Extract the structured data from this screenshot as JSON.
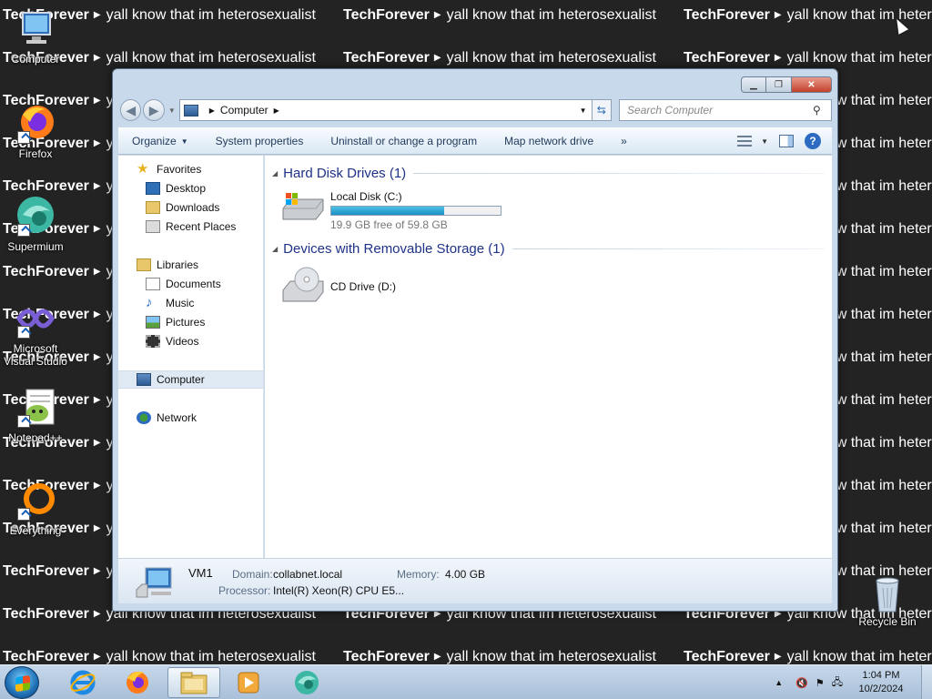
{
  "wallpaper": {
    "brand": "TechForever",
    "tagline": "yall know that im heterosexualist",
    "arrow_icon": "play-arrow-icon"
  },
  "desktop_icons": [
    {
      "id": "computer",
      "label": "Computer",
      "icon": "computer-icon"
    },
    {
      "id": "firefox",
      "label": "Firefox",
      "icon": "firefox-icon"
    },
    {
      "id": "supermium",
      "label": "Supermium",
      "icon": "supermium-icon"
    },
    {
      "id": "visual-studio",
      "label": "Microsoft Visual Studio",
      "icon": "visual-studio-icon"
    },
    {
      "id": "notepadpp",
      "label": "Notepad++",
      "icon": "notepadpp-icon"
    },
    {
      "id": "everything",
      "label": "Everything",
      "icon": "everything-icon"
    },
    {
      "id": "recycle-bin",
      "label": "Recycle Bin",
      "icon": "recycle-bin-icon"
    }
  ],
  "explorer": {
    "address": {
      "location": "Computer"
    },
    "search": {
      "placeholder": "Search Computer"
    },
    "toolbar": {
      "organize": "Organize",
      "system_properties": "System properties",
      "uninstall": "Uninstall or change a program",
      "map_drive": "Map network drive",
      "overflow": "»"
    },
    "nav": {
      "favorites": "Favorites",
      "desktop": "Desktop",
      "downloads": "Downloads",
      "recent_places": "Recent Places",
      "libraries": "Libraries",
      "documents": "Documents",
      "music": "Music",
      "pictures": "Pictures",
      "videos": "Videos",
      "computer": "Computer",
      "network": "Network"
    },
    "groups": {
      "hdd": "Hard Disk Drives (1)",
      "removable": "Devices with Removable Storage (1)"
    },
    "drives": {
      "c": {
        "name": "Local Disk (C:)",
        "free_text": "19.9 GB free of 59.8 GB",
        "used_fraction": 0.667
      },
      "d": {
        "name": "CD Drive (D:)"
      }
    },
    "details": {
      "name": "VM1",
      "domain_label": "Domain:",
      "domain": "collabnet.local",
      "memory_label": "Memory:",
      "memory": "4.00 GB",
      "processor_label": "Processor:",
      "processor": "Intel(R) Xeon(R) CPU E5..."
    }
  },
  "taskbar": {
    "pinned": [
      "internet-explorer-icon",
      "firefox-icon",
      "windows-explorer-icon",
      "media-player-icon",
      "supermium-icon"
    ],
    "clock_time": "1:04 PM",
    "clock_date": "10/2/2024"
  },
  "colors": {
    "accent": "#1e3287",
    "drive_bar": "#1b8ec2",
    "taskbar": "#b5c9de",
    "wallpaper": "#232323"
  }
}
